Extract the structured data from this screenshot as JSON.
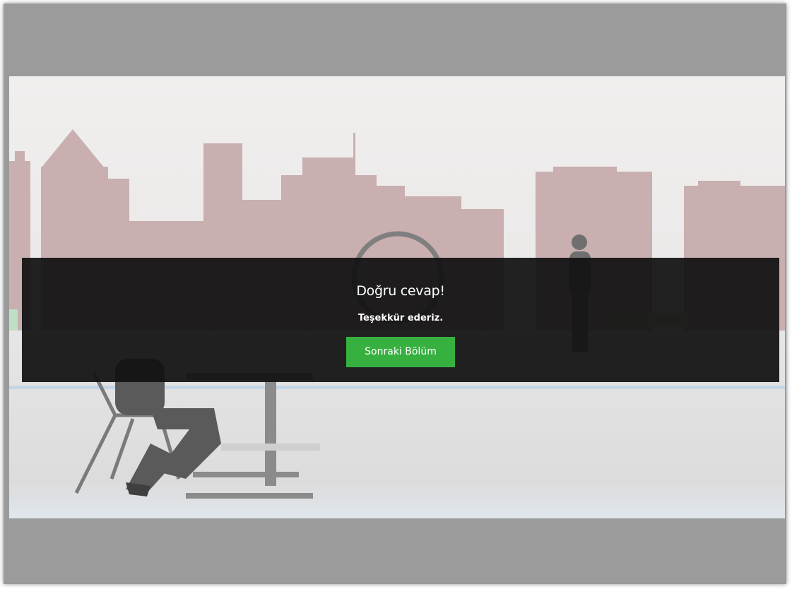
{
  "feedback": {
    "title": "Doğru cevap!",
    "subtitle": "Teşekkür ederiz.",
    "next_button_label": "Sonraki Bölüm"
  },
  "colors": {
    "frame": "#9b9b9b",
    "overlay": "#111111",
    "button": "#36b13f",
    "skyline": "#c7aeae"
  }
}
